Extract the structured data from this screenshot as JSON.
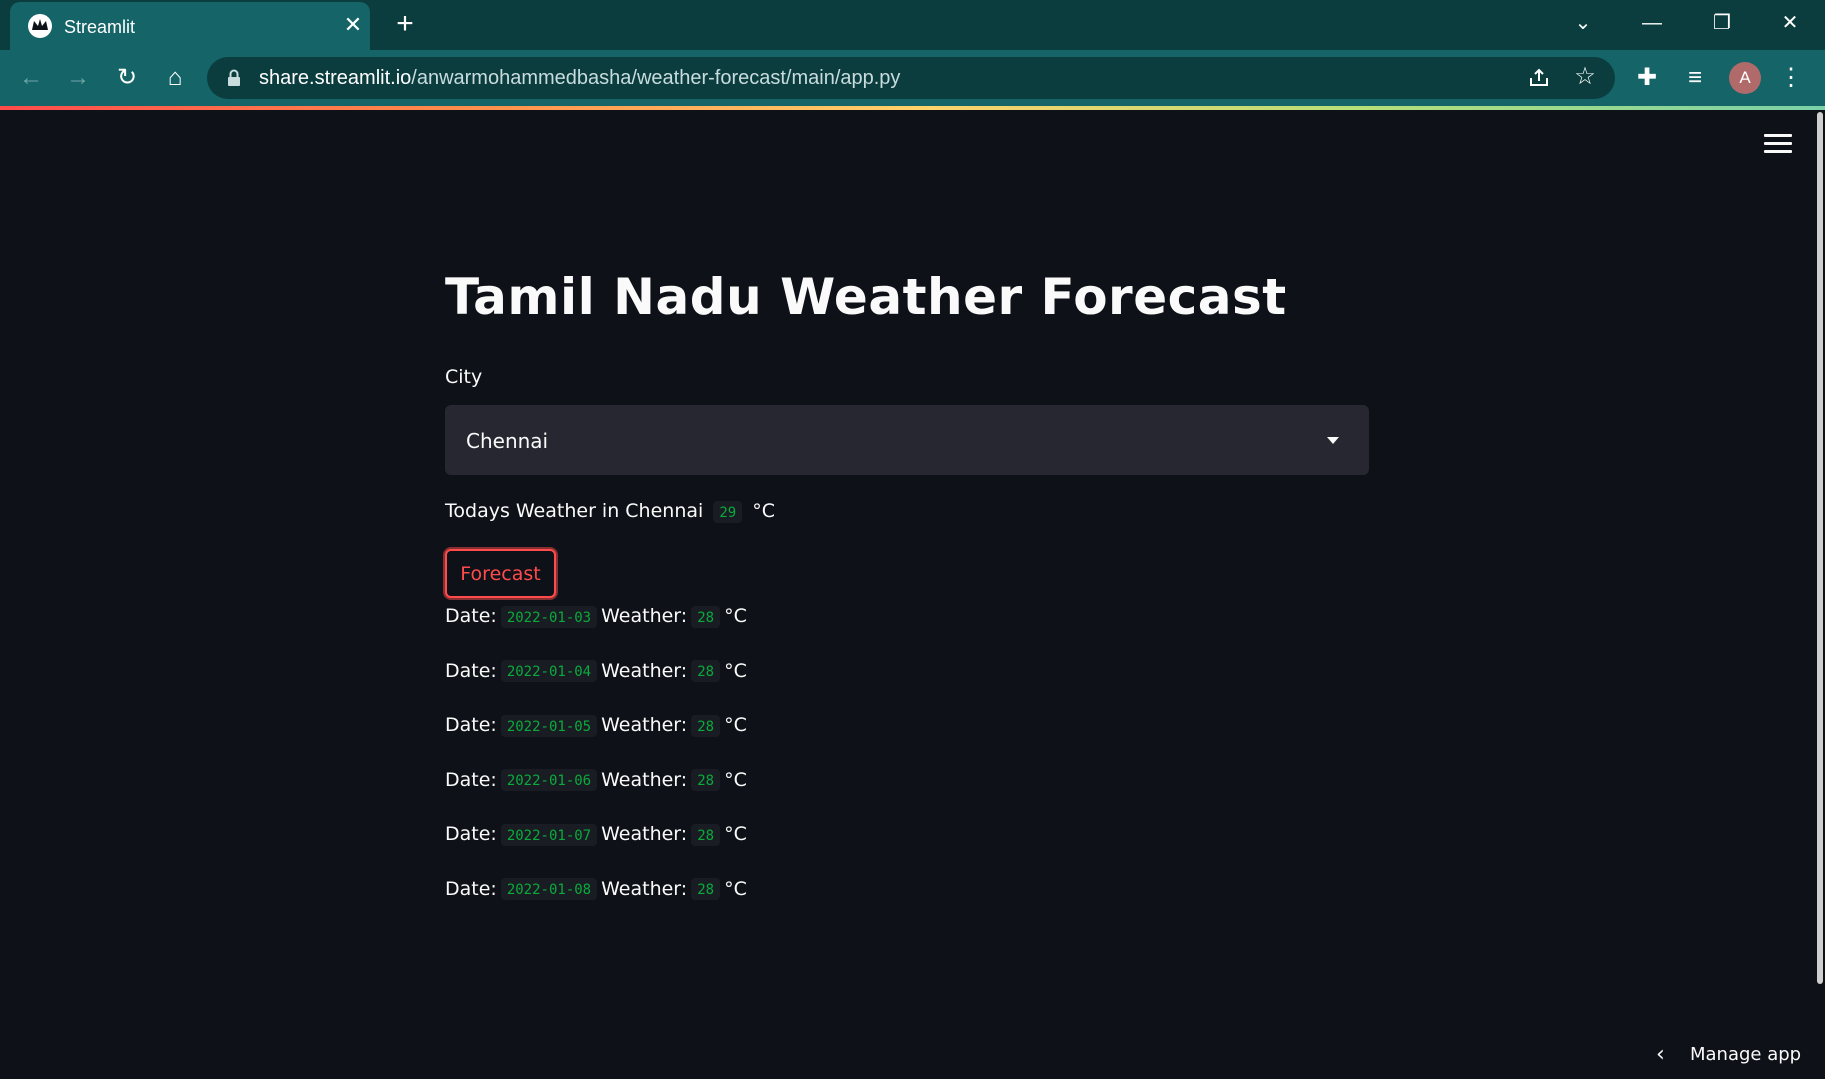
{
  "browser": {
    "tab_title": "Streamlit",
    "url_host": "share.streamlit.io",
    "url_path": "/anwarmohammedbasha/weather-forecast/main/app.py",
    "avatar_letter": "A"
  },
  "app": {
    "title": "Tamil Nadu Weather Forecast",
    "city_label": "City",
    "city_selected": "Chennai",
    "today_prefix": "Todays Weather in Chennai",
    "today_temp": "29",
    "unit": "°C",
    "forecast_button": "Forecast",
    "date_label": "Date:",
    "weather_label": "Weather:",
    "forecast": [
      {
        "date": "2022-01-03",
        "temp": "28"
      },
      {
        "date": "2022-01-04",
        "temp": "28"
      },
      {
        "date": "2022-01-05",
        "temp": "28"
      },
      {
        "date": "2022-01-06",
        "temp": "28"
      },
      {
        "date": "2022-01-07",
        "temp": "28"
      },
      {
        "date": "2022-01-08",
        "temp": "28"
      }
    ],
    "manage_app": "Manage app"
  },
  "colors": {
    "accent": "#ff4b4b",
    "code_text": "#09ab3b",
    "chrome_dark": "#0b3d3f",
    "chrome_light": "#146468",
    "background": "#0e1117"
  },
  "icons": [
    "streamlit-favicon",
    "close-icon",
    "plus-icon",
    "chevron-down-icon",
    "minimize-icon",
    "restore-icon",
    "back-arrow-icon",
    "forward-arrow-icon",
    "reload-icon",
    "home-icon",
    "lock-icon",
    "share-icon",
    "star-icon",
    "extensions-icon",
    "media-icon",
    "kebab-menu-icon",
    "hamburger-icon",
    "chevron-left-icon"
  ]
}
